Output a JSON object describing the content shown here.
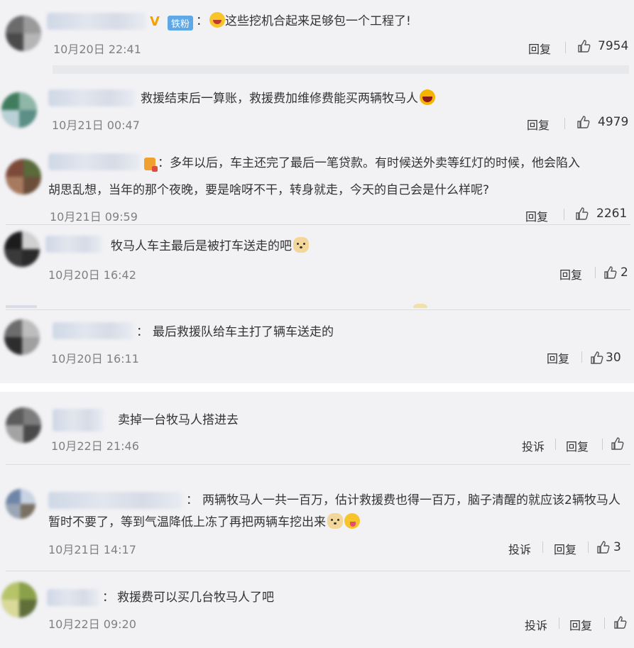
{
  "colors": {
    "background": "#f2f2f5",
    "white_band": "#ffffff",
    "timestamp": "#808080",
    "vip_badge": "#f4a100",
    "fan_badge": "#5fa8e8"
  },
  "badges": {
    "vip_icon": "V",
    "fan_label": "铁粉"
  },
  "actions": {
    "reply": "回复",
    "report": "投诉",
    "like_icon": "thumbs-up-icon"
  },
  "comments": [
    {
      "prefix": "：",
      "text": "这些挖机合起来足够包一个工程了!",
      "time": "10月20日 22:41",
      "likes": "7954"
    },
    {
      "text": "救援结束后一算账，救援费加维修费能买两辆牧马人",
      "time": "10月21日 00:47",
      "likes": "4979"
    },
    {
      "prefix": "：",
      "line1": "多年以后，车主还完了最后一笔贷款。有时候送外卖等红灯的时候，他会陷入",
      "line2": "胡思乱想，当年的那个夜晚，要是啥呀不干，转身就走，今天的自己会是什么样呢?",
      "time": "10月21日 09:59",
      "likes": "2261"
    },
    {
      "text": "牧马人车主最后是被打车送走的吧",
      "time": "10月20日 16:42",
      "likes": "2"
    },
    {
      "prefix": "：",
      "text": "最后救援队给车主打了辆车送走的",
      "time": "10月20日 16:11",
      "likes": "30"
    },
    {
      "text": "卖掉一台牧马人搭进去",
      "time": "10月22日 21:46"
    },
    {
      "prefix": "：",
      "line1": "两辆牧马人一共一百万，估计救援费也得一百万，脑子清醒的就应该2辆牧马人",
      "line2": "暂时不要了，等到气温降低上冻了再把两辆车挖出来",
      "time": "10月21日 14:17",
      "likes": "3"
    },
    {
      "prefix": "：",
      "text": "救援费可以买几台牧马人了吧",
      "time": "10月22日 09:20"
    }
  ]
}
